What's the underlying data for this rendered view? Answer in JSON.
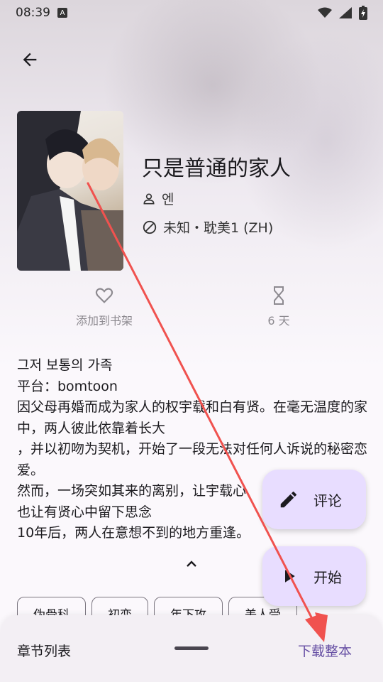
{
  "status_bar": {
    "time": "08:39",
    "badge": "A"
  },
  "book": {
    "title": "只是普通的家人",
    "author": "엔",
    "status_genre": "未知・耽美1 (ZH)"
  },
  "actions": {
    "add_shelf": "添加到书架",
    "interval": "6 天"
  },
  "description": "그저 보통의 가족\n平台：bomtoon\n因父母再婚而成为家人的权宇载和白有贤。在毫无温度的家中，两人彼此依靠着长大\n，并以初吻为契机，开始了一段无法对任何人诉说的秘密恋爱。\n然而，一场突如其来的离别，让宇载心\n也让有贤心中留下思念\n10年后，两人在意想不到的地方重逢。",
  "tags": [
    "伪骨科",
    "初恋",
    "年下攻",
    "美人受"
  ],
  "fabs": {
    "comment": "评论",
    "start": "开始"
  },
  "bottom_sheet": {
    "chapter_list": "章节列表",
    "download_all": "下载整本"
  },
  "colors": {
    "accent": "#6750a4",
    "fab_bg": "#e8ddff",
    "annotation_arrow": "#f0524f"
  }
}
